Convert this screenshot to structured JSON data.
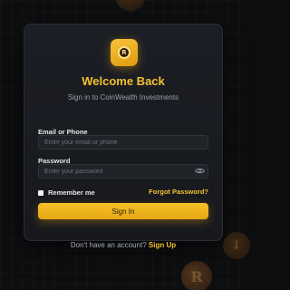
{
  "brand": {
    "accent": "#f2c12e",
    "logo_icon": "coin-r-icon",
    "logo_glyph": "R"
  },
  "header": {
    "title": "Welcome Back",
    "subtitle": "Sign in to CoinWealth Investments"
  },
  "form": {
    "email_label": "Email or Phone",
    "email_placeholder": "Enter your email or phone",
    "email_value": "",
    "password_label": "Password",
    "password_placeholder": "Enter your password",
    "password_value": "",
    "password_toggle_icon": "eye-icon",
    "remember_label": "Remember me",
    "remember_checked": false,
    "forgot_label": "Forgot Password?",
    "submit_label": "Sign In"
  },
  "footer": {
    "prompt": "Don't have an account?",
    "signup_label": "Sign Up"
  },
  "background": {
    "coin_glyph": "R",
    "decor_glyph": "↓"
  }
}
